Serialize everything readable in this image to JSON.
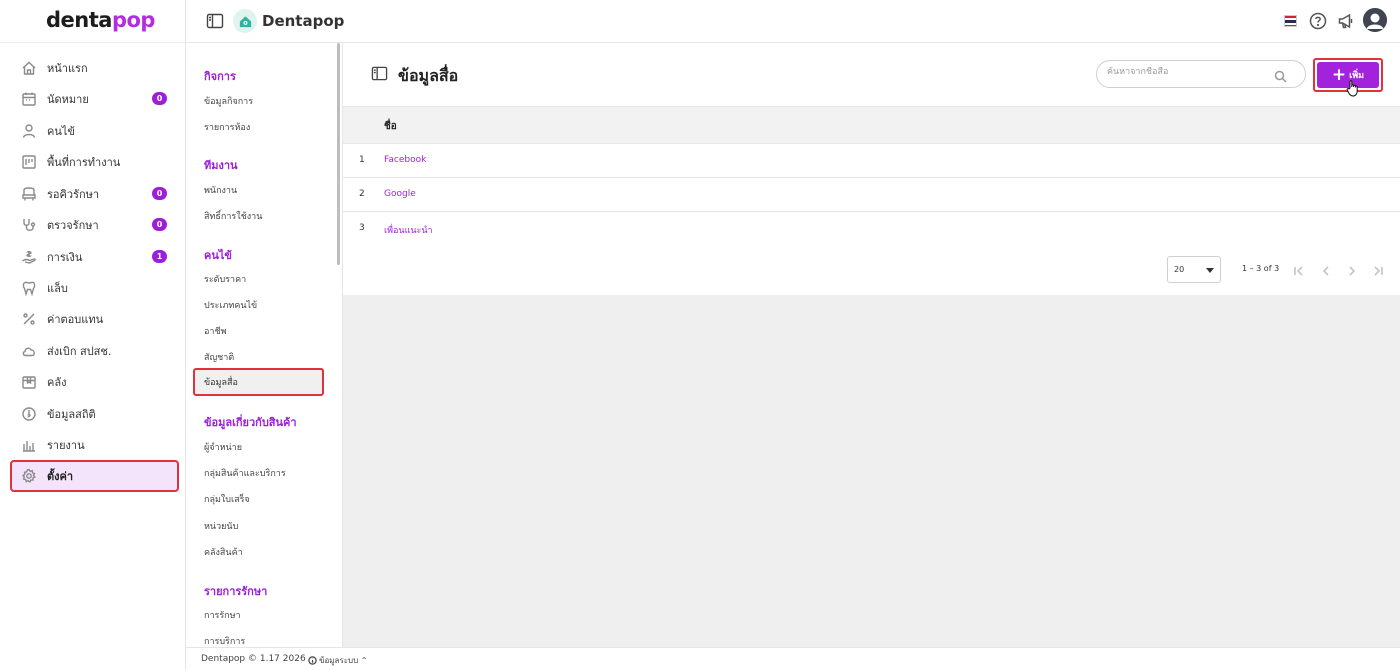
{
  "app": {
    "logo_part1": "denta",
    "logo_part2": "pop",
    "brand_name": "Dentapop"
  },
  "colors": {
    "accent": "#a322dc",
    "badge": "#9b1fd8",
    "highlight_border": "#e0323a"
  },
  "sidebar": {
    "items": [
      {
        "label": "หน้าแรก",
        "icon": "home-icon"
      },
      {
        "label": "นัดหมาย",
        "icon": "calendar-icon",
        "badge": "0"
      },
      {
        "label": "คนไข้",
        "icon": "user-icon"
      },
      {
        "label": "พื้นที่การทำงาน",
        "icon": "workspace-icon"
      },
      {
        "label": "รอคิวรักษา",
        "icon": "chair-icon",
        "badge": "0"
      },
      {
        "label": "ตรวจรักษา",
        "icon": "stethoscope-icon",
        "badge": "0"
      },
      {
        "label": "การเงิน",
        "icon": "money-icon",
        "badge": "1"
      },
      {
        "label": "แล็บ",
        "icon": "tooth-icon"
      },
      {
        "label": "ค่าตอบแทน",
        "icon": "percent-icon"
      },
      {
        "label": "ส่งเบิก สปสช.",
        "icon": "cloud-icon"
      },
      {
        "label": "คลัง",
        "icon": "box-icon"
      },
      {
        "label": "ข้อมูลสถิติ",
        "icon": "stats-icon"
      },
      {
        "label": "รายงาน",
        "icon": "report-icon"
      },
      {
        "label": "ตั้งค่า",
        "icon": "gear-icon"
      }
    ]
  },
  "submenu": {
    "groups": [
      {
        "title": "กิจการ",
        "items": [
          "ข้อมูลกิจการ",
          "รายการห้อง"
        ]
      },
      {
        "title": "ทีมงาน",
        "items": [
          "พนักงาน",
          "สิทธิ์การใช้งาน"
        ]
      },
      {
        "title": "คนไข้",
        "items": [
          "ระดับราคา",
          "ประเภทคนไข้",
          "อาชีพ",
          "สัญชาติ",
          "ข้อมูลสื่อ"
        ]
      },
      {
        "title": "ข้อมูลเกี่ยวกับสินค้า",
        "items": [
          "ผู้จำหน่าย",
          "กลุ่มสินค้าและบริการ",
          "กลุ่มใบเสร็จ",
          "หน่วยนับ",
          "คลังสินค้า"
        ]
      },
      {
        "title": "รายการรักษา",
        "items": [
          "การรักษา",
          "การบริการ"
        ]
      }
    ]
  },
  "main": {
    "title": "ข้อมูลสื่อ",
    "search_placeholder": "ค้นหาจากชื่อสื่อ",
    "add_label": "เพิ่ม",
    "table": {
      "header": "ชื่อ",
      "rows": [
        {
          "no": "1",
          "name": "Facebook"
        },
        {
          "no": "2",
          "name": "Google"
        },
        {
          "no": "3",
          "name": "เพื่อนแนะนำ"
        }
      ]
    },
    "pager": {
      "page_size": "20",
      "range": "1 – 3 of 3"
    }
  },
  "footer": {
    "version": "Dentapop © 1.17 2026",
    "info": "ข้อมูลระบบ ⌃"
  }
}
